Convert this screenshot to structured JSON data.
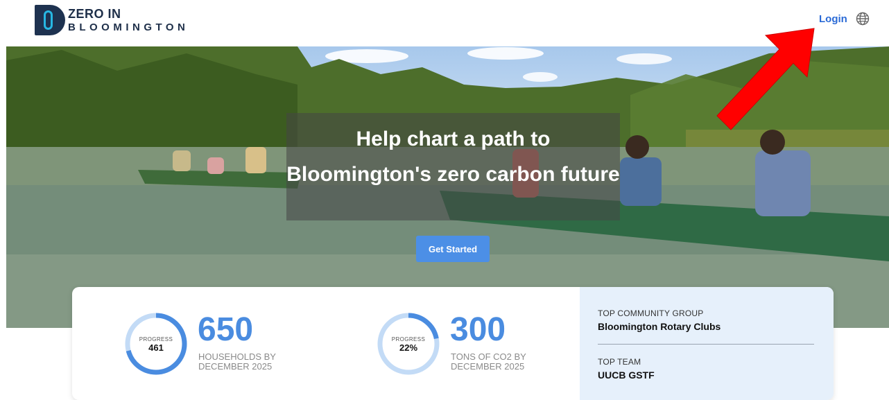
{
  "header": {
    "logo": {
      "line1": "ZERO IN",
      "line2": "BLOOMINGTON"
    },
    "login_label": "Login",
    "language_icon": "globe-icon"
  },
  "hero": {
    "title": "Help chart a path to Bloomington's zero carbon future",
    "cta_label": "Get Started",
    "image_subject": "people paddling canoes on a lake surrounded by trees"
  },
  "stats": [
    {
      "ring_label": "PROGRESS",
      "ring_value": "461",
      "ring_fraction": 0.71,
      "number": "650",
      "caption": "HOUSEHOLDS BY DECEMBER 2025"
    },
    {
      "ring_label": "PROGRESS",
      "ring_value": "22%",
      "ring_fraction": 0.22,
      "number": "300",
      "caption": "TONS OF CO2 BY DECEMBER 2025"
    }
  ],
  "top_panel": {
    "group_label": "TOP COMMUNITY GROUP",
    "group_value": "Bloomington Rotary Clubs",
    "team_label": "TOP TEAM",
    "team_value": "UUCB GSTF"
  },
  "colors": {
    "brand_navy": "#1e3250",
    "brand_cyan": "#27b7e3",
    "accent_blue": "#4a8ce0",
    "link_blue": "#2a6ad6",
    "ring_track": "#c3dbf6",
    "panel_bg": "#e6f0fb",
    "annotation_red": "#ff0000"
  },
  "annotation": {
    "type": "red-arrow",
    "points_to": "login-link"
  }
}
